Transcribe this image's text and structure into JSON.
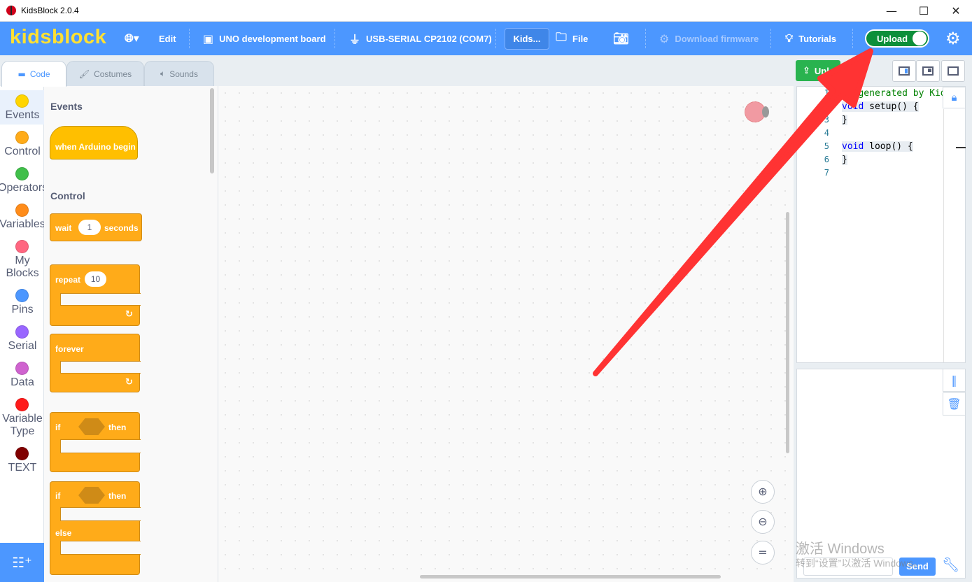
{
  "window": {
    "title": "KidsBlock 2.0.4"
  },
  "menubar": {
    "logo": "kidsblock",
    "language_icon": "globe-icon",
    "edit": "Edit",
    "board": "UNO development board",
    "port": "USB-SERIAL CP2102 (COM7)",
    "project": "Kids...",
    "file": "File",
    "download_firmware": "Download firmware",
    "tutorials": "Tutorials",
    "upload_toggle": "Upload"
  },
  "tabs": {
    "code": "Code",
    "costumes": "Costumes",
    "sounds": "Sounds"
  },
  "categories": [
    {
      "label": "Events",
      "color": "#ffd500"
    },
    {
      "label": "Control",
      "color": "#ffab19"
    },
    {
      "label": "Operators",
      "color": "#40bf4a"
    },
    {
      "label": "Variables",
      "color": "#ff8c1a"
    },
    {
      "label": "My Blocks",
      "color": "#ff6680"
    },
    {
      "label": "Pins",
      "color": "#4c97ff"
    },
    {
      "label": "Serial",
      "color": "#9966ff"
    },
    {
      "label": "Data",
      "color": "#cf63cf"
    },
    {
      "label": "Variable Type",
      "color": "#ff1a1a"
    },
    {
      "label": "TEXT",
      "color": "#800000"
    }
  ],
  "flyout": {
    "events_heading": "Events",
    "when_arduino_begin": "when Arduino begin",
    "control_heading": "Control",
    "wait": "wait",
    "wait_value": "1",
    "seconds": "seconds",
    "repeat": "repeat",
    "repeat_value": "10",
    "forever": "forever",
    "if": "if",
    "then": "then",
    "else": "else"
  },
  "code": {
    "upload_button": "Upload",
    "line_numbers": [
      "1",
      "2",
      "3",
      "4",
      "5",
      "6",
      "7"
    ],
    "comment": "// generated by KidsBlock",
    "lines": [
      "void setup() {",
      "}",
      "",
      "void loop() {",
      "}",
      ""
    ]
  },
  "serial": {
    "send": "Send"
  },
  "watermark": {
    "line1": "激活 Windows",
    "line2": "转到“设置”以激活 Windows。"
  }
}
